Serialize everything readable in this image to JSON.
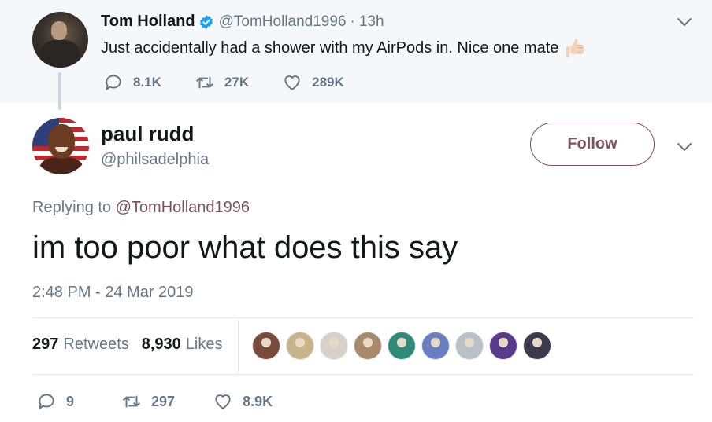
{
  "parent_tweet": {
    "author_name": "Tom Holland",
    "verified": true,
    "handle": "@TomHolland1996",
    "separator": "·",
    "time_ago": "13h",
    "text": "Just accidentally had a shower with my AirPods in. Nice one mate",
    "emoji_icon": "thumbs-up-icon",
    "reply_count": "8.1K",
    "retweet_count": "27K",
    "like_count": "289K"
  },
  "main_tweet": {
    "author_name": "paul rudd",
    "handle": "@philsadelphia",
    "follow_label": "Follow",
    "replying_prefix": "Replying to",
    "replying_handle": "@TomHolland1996",
    "text": "im too poor what does this say",
    "timestamp": "2:48 PM - 24 Mar 2019",
    "retweets_value": "297",
    "retweets_label": "Retweets",
    "likes_value": "8,930",
    "likes_label": "Likes",
    "liker_avatars": [
      {
        "name": "liker-avatar-1",
        "color": "#7a4b3a"
      },
      {
        "name": "liker-avatar-2",
        "color": "#c9b48a"
      },
      {
        "name": "liker-avatar-3",
        "color": "#d9d0c8"
      },
      {
        "name": "liker-avatar-4",
        "color": "#a88a6a"
      },
      {
        "name": "liker-avatar-5",
        "color": "#2f8a7a"
      },
      {
        "name": "liker-avatar-6",
        "color": "#6a7fc0"
      },
      {
        "name": "liker-avatar-7",
        "color": "#b8c0c8"
      },
      {
        "name": "liker-avatar-8",
        "color": "#5a3a8a"
      },
      {
        "name": "liker-avatar-9",
        "color": "#3a3a4a"
      }
    ],
    "reply_count": "9",
    "retweet_count": "297",
    "like_count": "8.9K"
  },
  "colors": {
    "accent": "#79525a",
    "muted_text": "#657786",
    "verified_blue": "#1da1f2",
    "parent_background": "#f5f8fa"
  }
}
